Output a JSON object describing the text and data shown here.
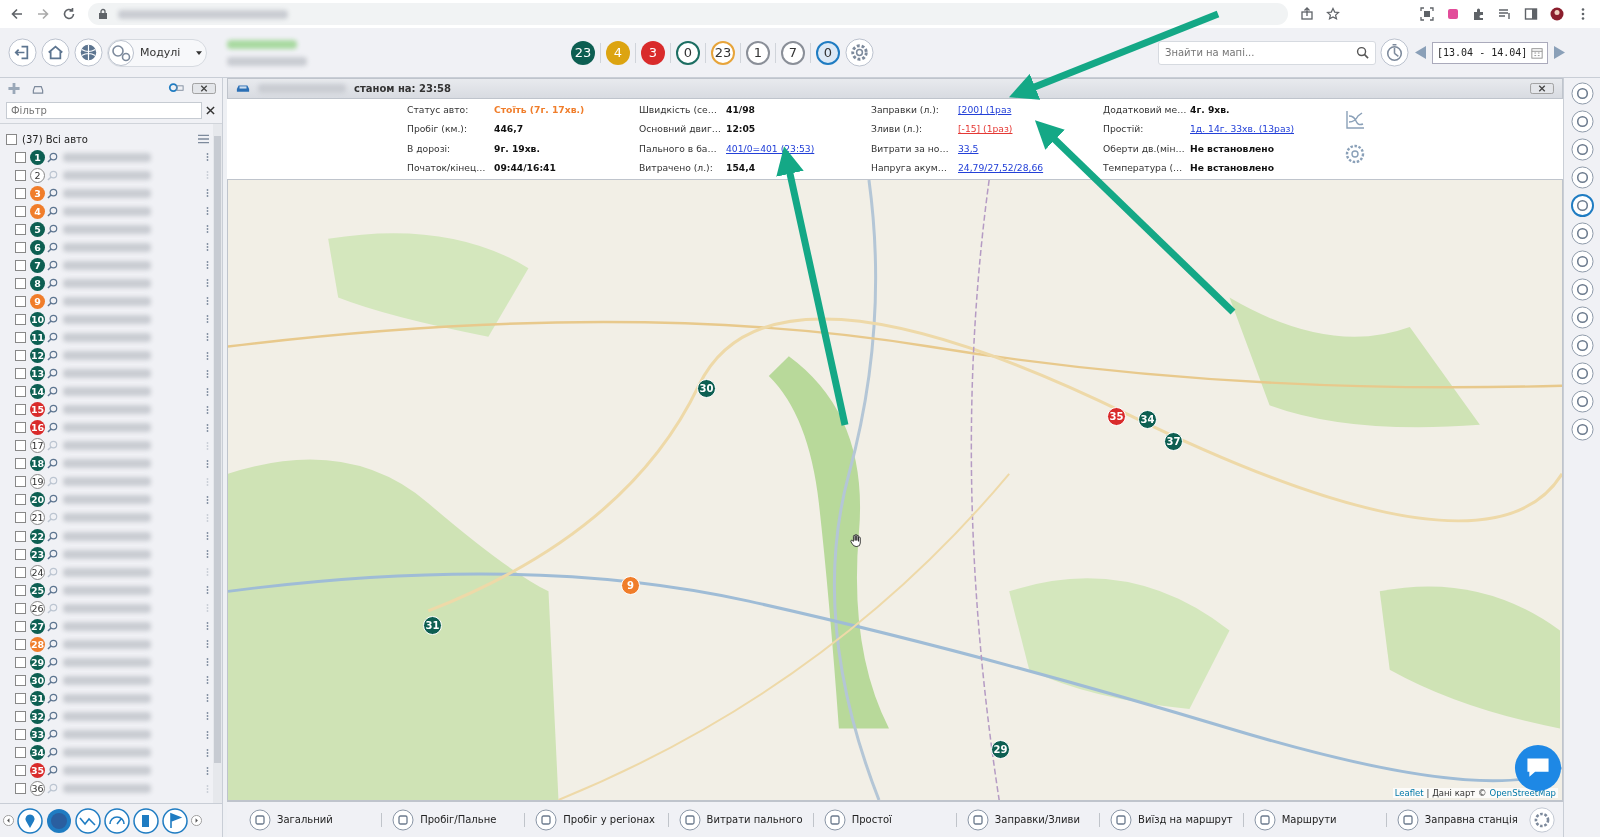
{
  "header": {
    "modules_label": "Модулі",
    "counters": [
      {
        "label": "23",
        "kind": "filled",
        "color": "#0d5f52"
      },
      {
        "label": "4",
        "kind": "filled",
        "color": "#dca411"
      },
      {
        "label": "3",
        "kind": "filled",
        "color": "#d92b2b"
      },
      {
        "label": "0",
        "kind": "outline",
        "color": "#1c6e62"
      },
      {
        "label": "23",
        "kind": "outline",
        "color": "#e7a43a"
      },
      {
        "label": "1",
        "kind": "outline",
        "color": "#8a8f98"
      },
      {
        "label": "7",
        "kind": "outline",
        "color": "#8a8f98"
      },
      {
        "label": "0",
        "kind": "map",
        "color": "#1f7cc2"
      }
    ],
    "search": {
      "placeholder": "Знайти на мапі..."
    },
    "date_range": "[13.04 - 14.04]"
  },
  "sidebar": {
    "filter": {
      "placeholder": "Фільтр"
    },
    "all": {
      "label": "(37) Всі авто",
      "checked": false
    },
    "vehicles": [
      {
        "number": "1",
        "color": "#0d5f52",
        "checked": false
      },
      {
        "number": "2",
        "color": "#ffffff",
        "checked": false
      },
      {
        "number": "3",
        "color": "#f07d2a",
        "checked": false
      },
      {
        "number": "4",
        "color": "#f07d2a",
        "checked": false
      },
      {
        "number": "5",
        "color": "#0d5f52",
        "checked": false
      },
      {
        "number": "6",
        "color": "#0d5f52",
        "checked": false
      },
      {
        "number": "7",
        "color": "#0d5f52",
        "checked": false
      },
      {
        "number": "8",
        "color": "#0d5f52",
        "checked": false
      },
      {
        "number": "9",
        "color": "#f07d2a",
        "checked": false
      },
      {
        "number": "10",
        "color": "#0d5f52",
        "checked": false
      },
      {
        "number": "11",
        "color": "#0d5f52",
        "checked": false
      },
      {
        "number": "12",
        "color": "#0d5f52",
        "checked": false
      },
      {
        "number": "13",
        "color": "#0d5f52",
        "checked": false
      },
      {
        "number": "14",
        "color": "#0d5f52",
        "checked": false
      },
      {
        "number": "15",
        "color": "#d92b2b",
        "checked": false
      },
      {
        "number": "16",
        "color": "#d92b2b",
        "checked": false
      },
      {
        "number": "17",
        "color": "#ffffff",
        "checked": false
      },
      {
        "number": "18",
        "color": "#0d5f52",
        "checked": false
      },
      {
        "number": "19",
        "color": "#ffffff",
        "checked": false
      },
      {
        "number": "20",
        "color": "#0d5f52",
        "checked": false
      },
      {
        "number": "21",
        "color": "#ffffff",
        "checked": false
      },
      {
        "number": "22",
        "color": "#0d5f52",
        "checked": false
      },
      {
        "number": "23",
        "color": "#0d5f52",
        "checked": false
      },
      {
        "number": "24",
        "color": "#ffffff",
        "checked": false
      },
      {
        "number": "25",
        "color": "#0d5f52",
        "checked": false
      },
      {
        "number": "26",
        "color": "#ffffff",
        "checked": false
      },
      {
        "number": "27",
        "color": "#0d5f52",
        "checked": false
      },
      {
        "number": "28",
        "color": "#f07d2a",
        "checked": false
      },
      {
        "number": "29",
        "color": "#0d5f52",
        "checked": false
      },
      {
        "number": "30",
        "color": "#0d5f52",
        "checked": false
      },
      {
        "number": "31",
        "color": "#0d5f52",
        "checked": false
      },
      {
        "number": "32",
        "color": "#0d5f52",
        "checked": false
      },
      {
        "number": "33",
        "color": "#0d5f52",
        "checked": false
      },
      {
        "number": "34",
        "color": "#0d5f52",
        "checked": false
      },
      {
        "number": "35",
        "color": "#d92b2b",
        "checked": false
      },
      {
        "number": "36",
        "color": "#ffffff",
        "checked": false
      }
    ]
  },
  "panel": {
    "title": "станом на: 23:58",
    "fields": [
      {
        "label": "Статус авто:",
        "value": "Стоїть (7г. 17хв.)",
        "kind": "status"
      },
      {
        "label": "Пробіг (км.):",
        "value": "446,7",
        "kind": "text"
      },
      {
        "label": "В дорозі:",
        "value": "9г. 19хв.",
        "kind": "text"
      },
      {
        "label": "Початок/кінец…",
        "value": "09:44/16:41",
        "kind": "text"
      },
      {
        "label": "Швидкість (се…",
        "value": "41/98",
        "kind": "text"
      },
      {
        "label": "Основний двиг…",
        "value": "12:05",
        "kind": "text"
      },
      {
        "label": "Пального в ба…",
        "value": "401/0=401 (23:53)",
        "kind": "link"
      },
      {
        "label": "Витрачено (л.):",
        "value": "154,4",
        "kind": "text"
      },
      {
        "label": "Заправки (л.):",
        "value": "[200] (1раз",
        "kind": "link"
      },
      {
        "label": "Зливи (л.):",
        "value": "[-15] (1раз)",
        "kind": "alert"
      },
      {
        "label": "Витрати за но…",
        "value": "33,5",
        "kind": "link"
      },
      {
        "label": "Напруга акум…",
        "value": "24,79/27,52/28,66",
        "kind": "link"
      },
      {
        "label": "Додатковий ме…",
        "value": "4г. 9хв.",
        "kind": "text"
      },
      {
        "label": "Простій:",
        "value": "1д. 14г. 33хв. (13раз)",
        "kind": "link"
      },
      {
        "label": "Оберти дв.(мін…",
        "value": "Не встановлено",
        "kind": "text"
      },
      {
        "label": "Температура (…",
        "value": "Не встановлено",
        "kind": "text"
      }
    ]
  },
  "map": {
    "markers": [
      {
        "label": "30",
        "color": "#0d5f52"
      },
      {
        "label": "35",
        "color": "#d92b2b"
      },
      {
        "label": "34",
        "color": "#0d5f52"
      },
      {
        "label": "37",
        "color": "#0d5f52"
      },
      {
        "label": "9",
        "color": "#f07d2a"
      },
      {
        "label": "31",
        "color": "#0d5f52"
      },
      {
        "label": "29",
        "color": "#0d5f52"
      }
    ],
    "attribution": {
      "link": "Leaflet",
      "text": "| Дані карт ©",
      "source": "OpenStreetMap"
    }
  },
  "bottom_tabs": [
    "Загальний",
    "Пробіг/Пальне",
    "Пробіг у регіонах",
    "Витрати пального",
    "Простої",
    "Заправки/Зливи",
    "Виїзд на маршрут",
    "Маршрути",
    "Заправна станція"
  ]
}
